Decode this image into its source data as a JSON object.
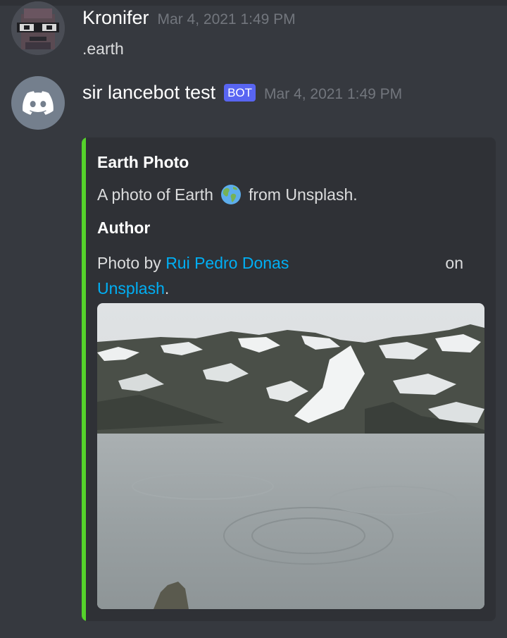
{
  "messages": [
    {
      "username": "Kronifer",
      "timestamp": "Mar 4, 2021 1:49 PM",
      "content": ".earth",
      "avatar_icon": "pixel-character-avatar"
    },
    {
      "username": "sir lancebot test",
      "bot_tag": "BOT",
      "timestamp": "Mar 4, 2021 1:49 PM",
      "avatar_icon": "discord-logo-icon",
      "embed": {
        "accent_color": "#55d22b",
        "title": "Earth Photo",
        "description_before": "A photo of Earth",
        "description_emoji": "globe-americas-emoji",
        "description_after": "from Unsplash.",
        "field_name": "Author",
        "field_prefix": "Photo by",
        "photographer": "Rui Pedro Donas",
        "field_middle": "on",
        "source_link": "Unsplash",
        "field_suffix": ".",
        "image_alt": "snowy mountains around a frozen lake"
      }
    }
  ],
  "colors": {
    "background": "#36393f",
    "embed_background": "#2f3136",
    "link": "#00aff4",
    "bot_tag": "#5865f2",
    "timestamp": "#72767d"
  }
}
